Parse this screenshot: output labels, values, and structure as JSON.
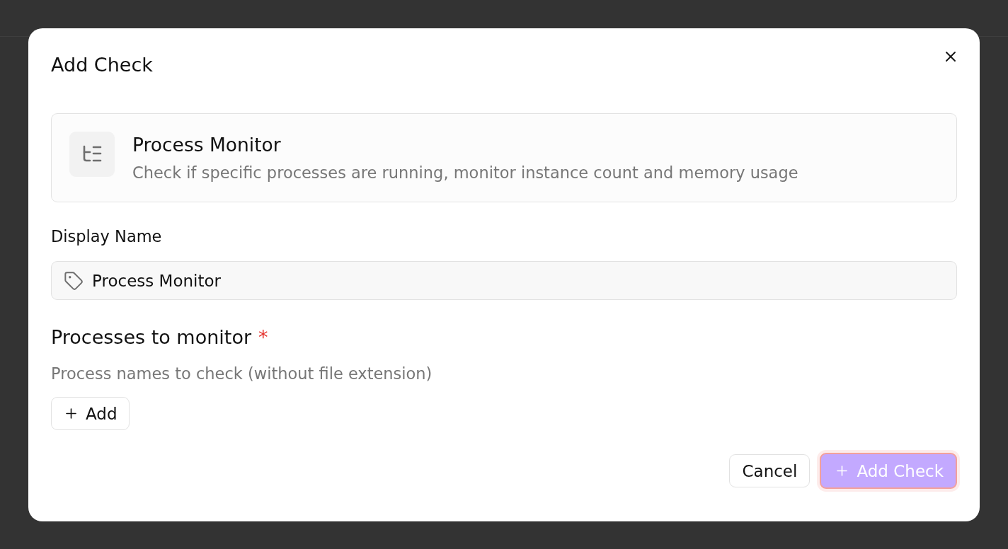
{
  "dialog": {
    "title": "Add Check"
  },
  "check_type": {
    "name": "Process Monitor",
    "description": "Check if specific processes are running, monitor instance count and memory usage"
  },
  "display_name": {
    "label": "Display Name",
    "value": "Process Monitor"
  },
  "processes": {
    "label": "Processes to monitor",
    "required_mark": "*",
    "hint": "Process names to check (without file extension)",
    "add_button": "Add"
  },
  "footer": {
    "buttons": [
      {
        "kind": "secondary",
        "label": "Cancel",
        "disabled": false,
        "focused": false
      },
      {
        "kind": "primary",
        "label": "Add Check",
        "disabled": true,
        "focused": true
      }
    ]
  }
}
